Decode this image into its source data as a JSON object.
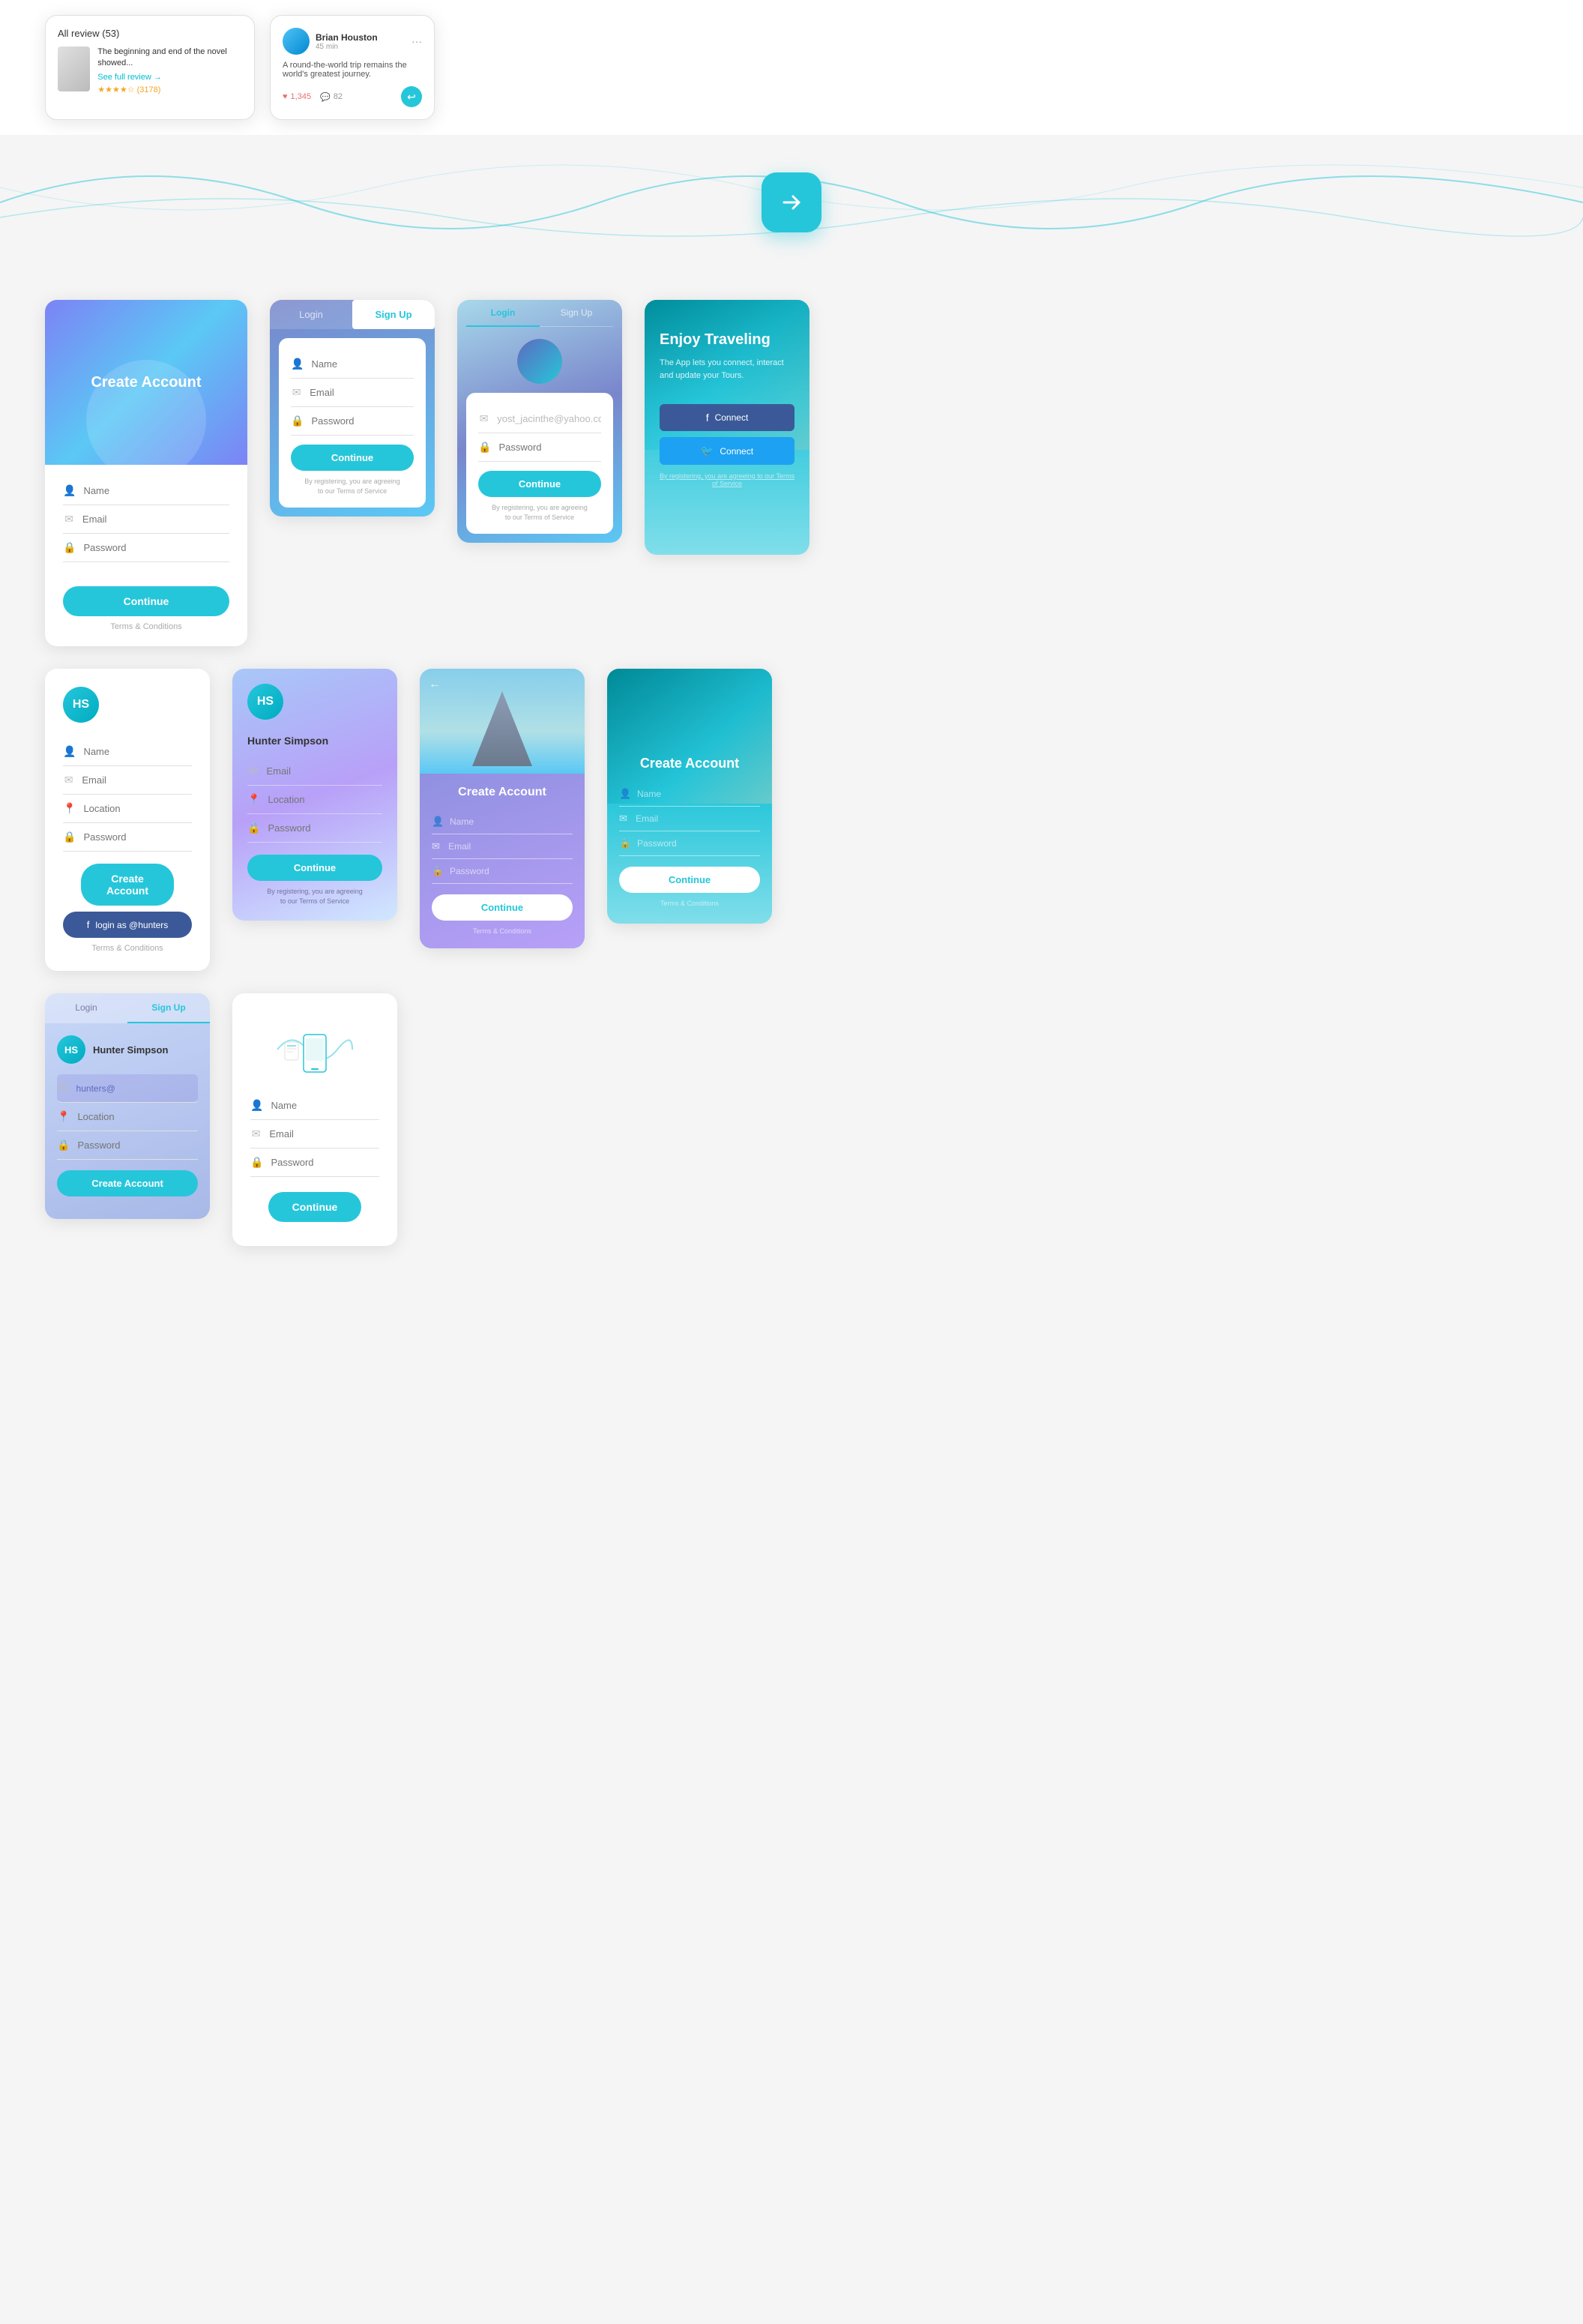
{
  "top": {
    "review_card": {
      "all_review": "All review (53)",
      "book_title": "The beginning and end of the novel showed...",
      "see_full": "See full review →",
      "stars": "★★★★☆ (3178)"
    },
    "social_card": {
      "name": "Brian Houston",
      "time": "45 min",
      "body": "A round-the-world trip remains the world's greatest journey.",
      "likes": "1,345",
      "comments": "82"
    }
  },
  "wave": {
    "arrow": "→"
  },
  "card1": {
    "title": "Create Account",
    "name_placeholder": "Name",
    "email_placeholder": "Email",
    "password_placeholder": "Password",
    "btn_continue": "Continue",
    "terms": "Terms & Conditions"
  },
  "card2_login": {
    "tab_login": "Login",
    "tab_signup": "Sign Up",
    "name_placeholder": "Name",
    "email_placeholder": "Email",
    "password_placeholder": "Password",
    "btn_continue": "Continue",
    "terms1": "By registering, you are agreeing",
    "terms2": "to our Terms of Service"
  },
  "card3_login": {
    "tab_login": "Login",
    "tab_signup": "Sign Up",
    "email_value": "yost_jacinthe@yahoo.com",
    "password_placeholder": "Password",
    "btn_continue": "Continue",
    "terms1": "By registering, you are agreeing",
    "terms2": "to our Terms of Service"
  },
  "card4_travel": {
    "title": "Enjoy Traveling",
    "description": "The App lets you connect, interact and update your Tours.",
    "btn_fb": "Connect",
    "btn_twitter": "Connect",
    "terms": "By registering, you are agreeing to our Terms of Service"
  },
  "card5_profile": {
    "avatar": "HS",
    "name_placeholder": "Name",
    "email_placeholder": "Email",
    "location_placeholder": "Location",
    "password_placeholder": "Password",
    "btn_create": "Create Account",
    "btn_fb": "login as @hunters",
    "terms": "Terms & Conditions"
  },
  "card6_hunter": {
    "avatar": "HS",
    "name": "Hunter Simpson",
    "email_placeholder": "Email",
    "location_placeholder": "Location",
    "password_placeholder": "Password",
    "btn_continue": "Continue",
    "terms1": "By registering, you are agreeing",
    "terms2": "to our Terms of Service"
  },
  "card7_mountain": {
    "back": "←",
    "title": "Create Account",
    "name_placeholder": "Name",
    "email_placeholder": "Email",
    "password_placeholder": "Password",
    "btn_continue": "Continue",
    "terms1": "Terms & Conditions"
  },
  "card8_travel_create": {
    "title": "Create Account",
    "name_placeholder": "Name",
    "email_placeholder": "Email",
    "password_placeholder": "Password",
    "btn_continue": "Continue",
    "terms": "Terms & Conditions"
  },
  "card9_signup": {
    "tab_login": "Login",
    "tab_signup": "Sign Up",
    "avatar": "HS",
    "name": "Hunter Simpson",
    "email_value": "hunters@",
    "location_placeholder": "Location",
    "password_placeholder": "Password",
    "btn_create": "Create Account"
  },
  "card10_plain": {
    "name_placeholder": "Name",
    "email_placeholder": "Email",
    "password_placeholder": "Password",
    "btn_continue": "Continue"
  }
}
